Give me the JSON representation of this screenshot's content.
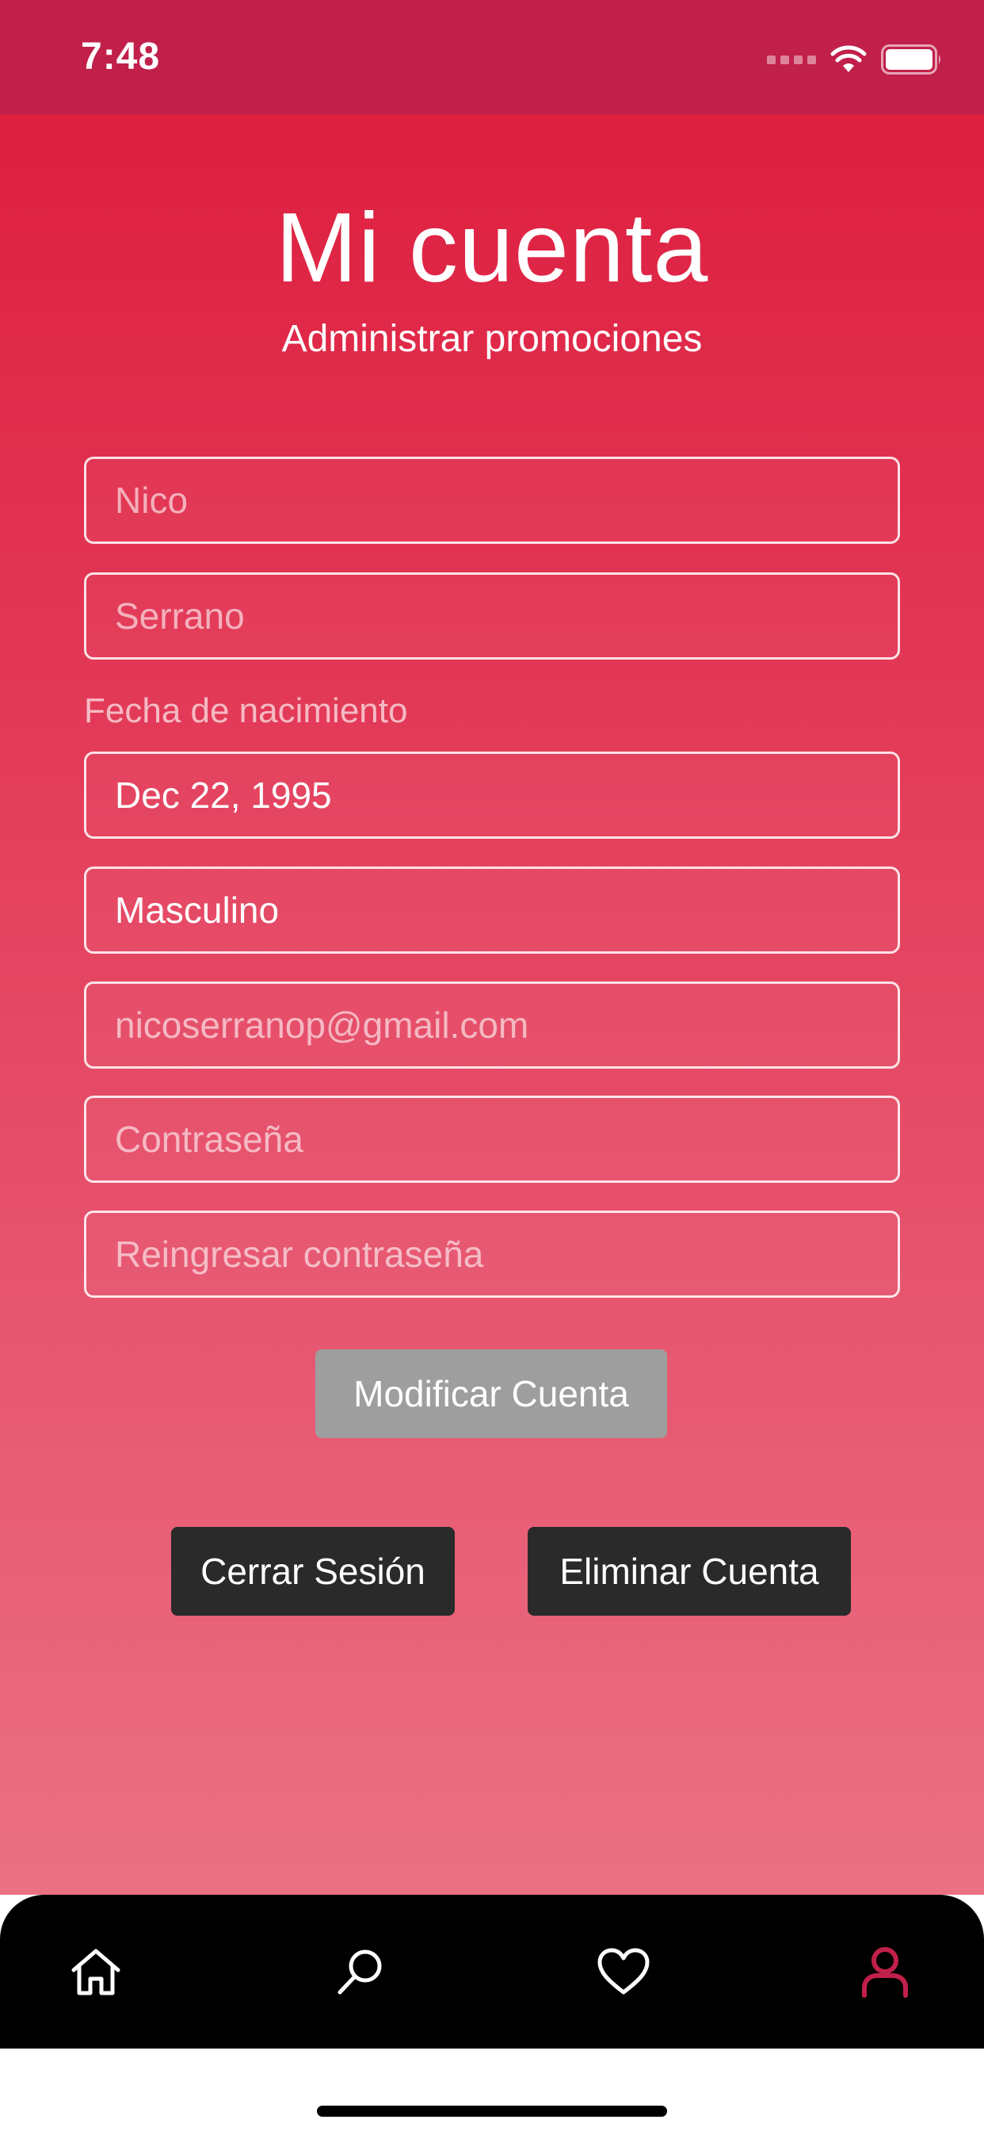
{
  "status_bar": {
    "time": "7:48",
    "icons": [
      "signal-icon",
      "wifi-icon",
      "battery-icon"
    ]
  },
  "header": {
    "title": "Mi cuenta",
    "subtitle": "Administrar promociones"
  },
  "form": {
    "first_name": {
      "value": "",
      "placeholder": "Nico"
    },
    "last_name": {
      "value": "",
      "placeholder": "Serrano"
    },
    "birthdate_label": "Fecha de nacimiento",
    "birthdate_value": "Dec 22, 1995",
    "gender_value": "Masculino",
    "email": {
      "value": "",
      "placeholder": "nicoserranop@gmail.com"
    },
    "password": {
      "value": "",
      "placeholder": "Contraseña"
    },
    "password_confirm": {
      "value": "",
      "placeholder": "Reingresar contraseña"
    }
  },
  "actions": {
    "modify_label": "Modificar Cuenta",
    "logout_label": "Cerrar Sesión",
    "delete_label": "Eliminar Cuenta"
  },
  "tab_bar": {
    "items": [
      {
        "icon": "home-icon",
        "active": false
      },
      {
        "icon": "search-icon",
        "active": false
      },
      {
        "icon": "heart-icon",
        "active": false
      },
      {
        "icon": "user-icon",
        "active": true
      }
    ]
  },
  "colors": {
    "status_bar_bg": "#c1204a",
    "gradient_top": "#de1f40",
    "gradient_bottom": "#ea7083",
    "active_tab": "#c1204a",
    "inactive_tab": "#ffffff",
    "button_disabled": "#9e9e9e",
    "button_dark": "#2a2a2a"
  }
}
